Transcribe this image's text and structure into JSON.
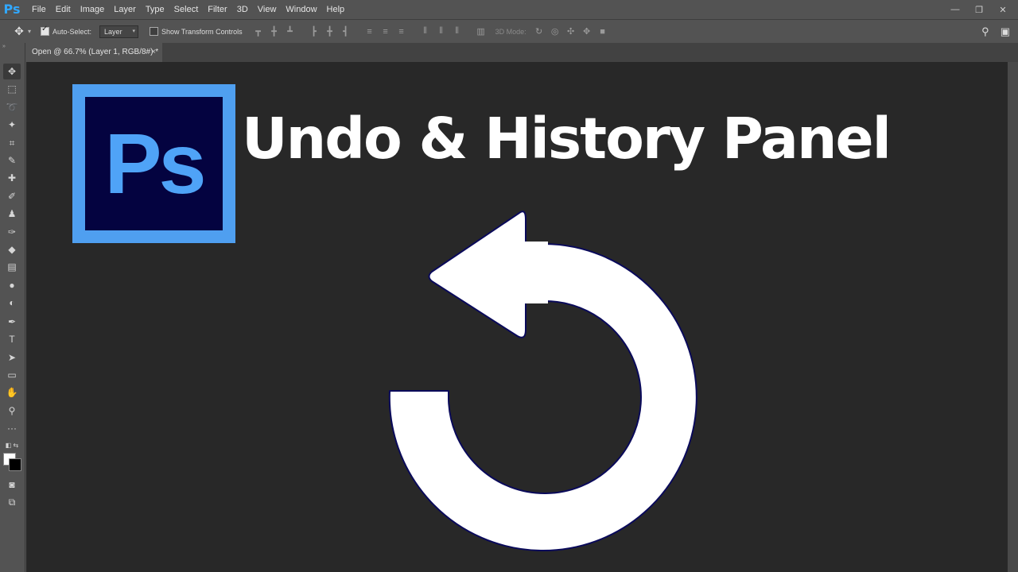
{
  "app": {
    "logo": "Ps"
  },
  "menu": [
    "File",
    "Edit",
    "Image",
    "Layer",
    "Type",
    "Select",
    "Filter",
    "3D",
    "View",
    "Window",
    "Help"
  ],
  "window_controls": {
    "minimize": "—",
    "restore": "❐",
    "close": "✕"
  },
  "options": {
    "auto_select_label": "Auto-Select:",
    "auto_select_checked": true,
    "auto_select_target": "Layer",
    "show_transform_label": "Show Transform Controls",
    "show_transform_checked": false,
    "mode_3d_label": "3D Mode:"
  },
  "document_tab": {
    "title": "Open @ 66.7% (Layer 1, RGB/8#) *",
    "close": "×"
  },
  "canvas": {
    "logo_text": "Ps",
    "headline": "Undo & History Panel",
    "colors": {
      "background": "#282828",
      "logo_border": "#4f9ff0",
      "logo_bg": "#040340",
      "logo_text": "#4fa3f7",
      "arrow": "#ffffff",
      "arrow_outline": "#0a0a5a"
    }
  },
  "tools": [
    "move-tool",
    "marquee-tool",
    "lasso-tool",
    "magic-wand-tool",
    "crop-tool",
    "eyedropper-tool",
    "healing-brush-tool",
    "brush-tool",
    "clone-stamp-tool",
    "history-brush-tool",
    "eraser-tool",
    "gradient-tool",
    "blur-tool",
    "dodge-tool",
    "pen-tool",
    "type-tool",
    "path-selection-tool",
    "rectangle-tool",
    "hand-tool",
    "zoom-tool",
    "more-tools"
  ]
}
